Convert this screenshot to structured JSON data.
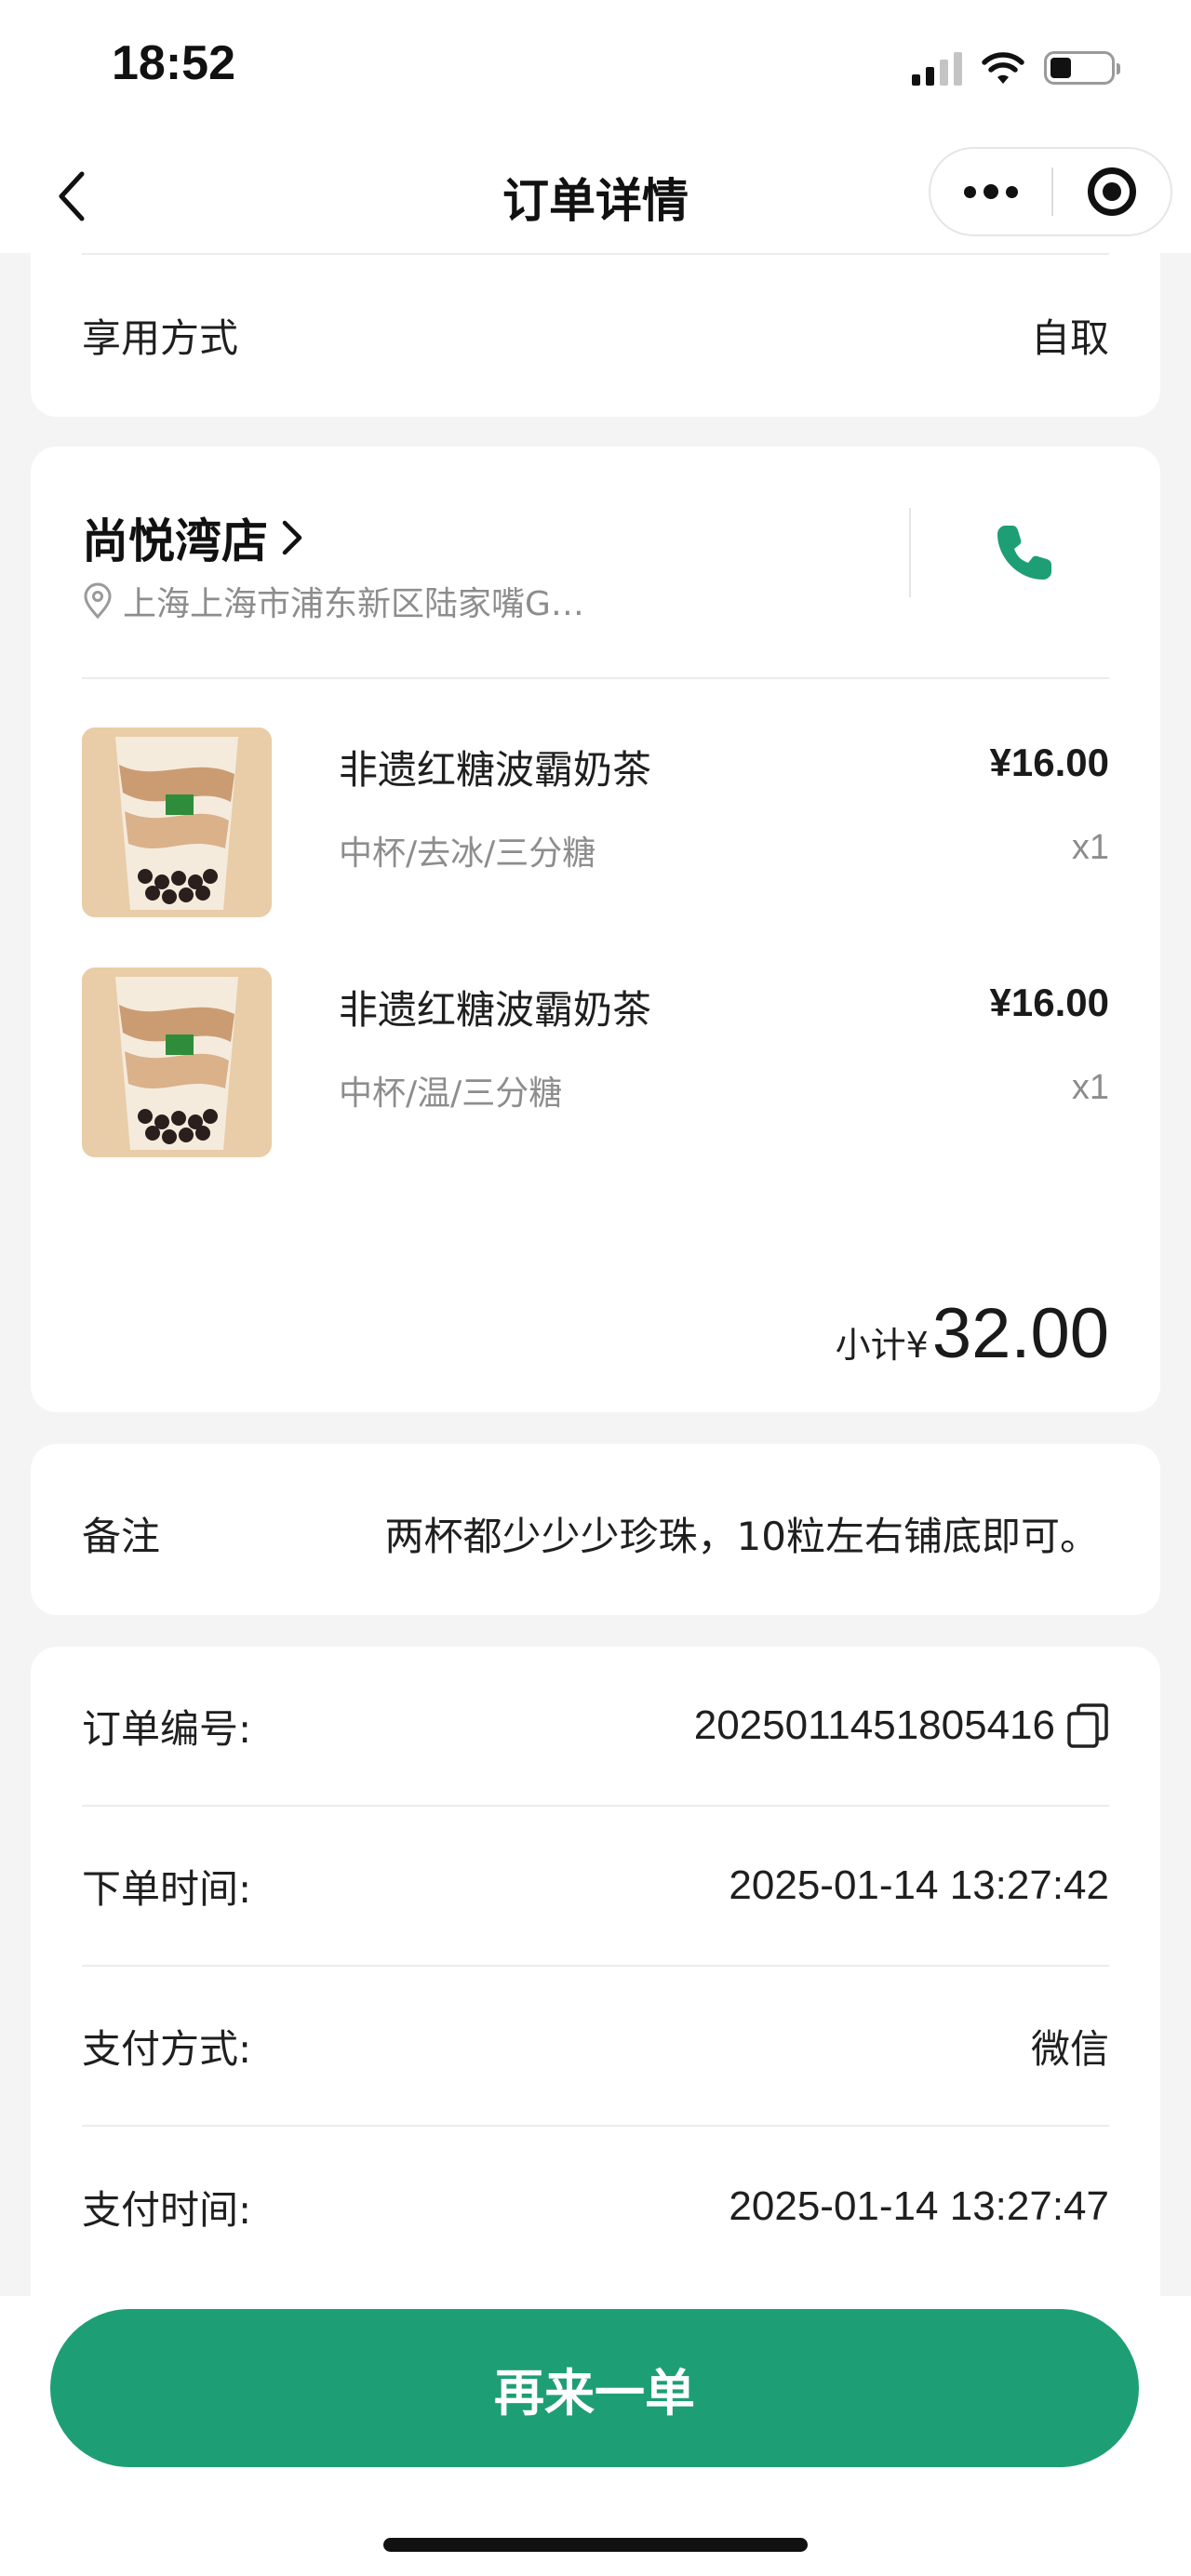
{
  "status_bar": {
    "time": "18:52"
  },
  "nav": {
    "title": "订单详情"
  },
  "fulfillment": {
    "label": "享用方式",
    "value": "自取"
  },
  "store": {
    "name": "尚悦湾店",
    "address": "上海上海市浦东新区陆家嘴G…"
  },
  "items": [
    {
      "name": "非遗红糖波霸奶茶",
      "spec": "中杯/去冰/三分糖",
      "price": "¥16.00",
      "qty": "x1"
    },
    {
      "name": "非遗红糖波霸奶茶",
      "spec": "中杯/温/三分糖",
      "price": "¥16.00",
      "qty": "x1"
    }
  ],
  "subtotal": {
    "label": "小计¥",
    "value": "32.00"
  },
  "note": {
    "label": "备注",
    "value": "两杯都少少少珍珠，10粒左右铺底即可。"
  },
  "order_info": [
    {
      "label": "订单编号:",
      "value": "2025011451805416"
    },
    {
      "label": "下单时间:",
      "value": "2025-01-14 13:27:42"
    },
    {
      "label": "支付方式:",
      "value": "微信"
    },
    {
      "label": "支付时间:",
      "value": "2025-01-14 13:27:47"
    }
  ],
  "actions": {
    "reorder_label": "再来一单"
  },
  "colors": {
    "brand_green": "#1e9e74",
    "muted_text": "#8d8d8d"
  },
  "icons": {
    "back": "chevron-left-icon",
    "more": "more-dots-icon",
    "close": "target-circle-icon",
    "store_arrow": "chevron-right-icon",
    "location": "location-pin-icon",
    "phone": "phone-icon",
    "copy": "copy-icon"
  }
}
